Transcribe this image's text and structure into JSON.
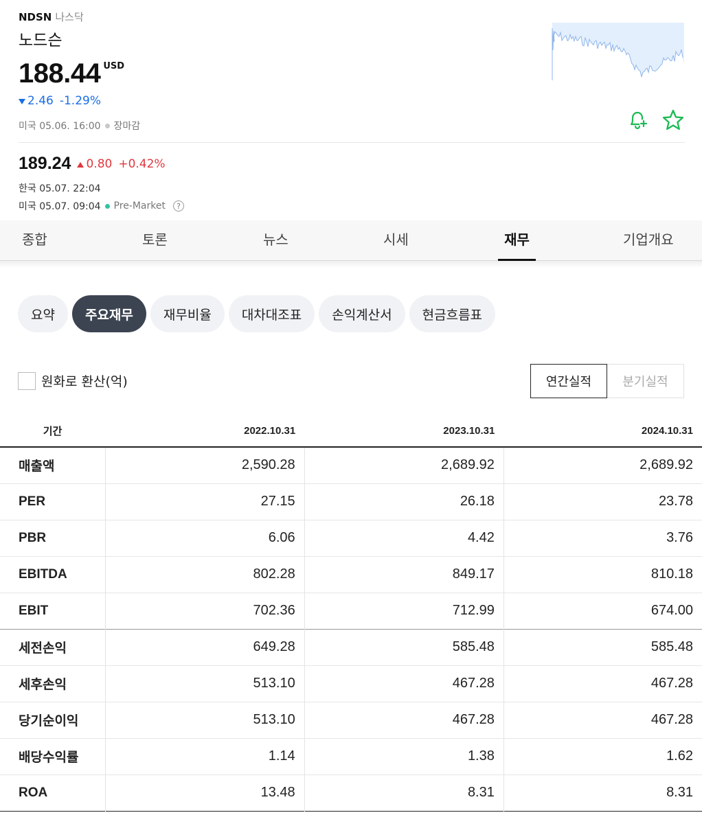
{
  "stock": {
    "ticker": "NDSN",
    "exchange": "나스닥",
    "name": "노드슨",
    "price": "188.44",
    "currency": "USD",
    "change": "2.46",
    "change_pct": "-1.29%",
    "market_time": "미국 05.06. 16:00",
    "market_status": "장마감"
  },
  "premarket": {
    "price": "189.24",
    "change": "0.80",
    "change_pct": "+0.42%",
    "kr_time": "한국 05.07. 22:04",
    "us_time": "미국 05.07. 09:04",
    "label": "Pre-Market"
  },
  "icons": {
    "alert": "bell-plus-icon",
    "favorite": "star-icon",
    "help": "question-circle-icon"
  },
  "colors": {
    "down": "#1a6ee6",
    "up": "#e0383e",
    "accent_green": "#1db954",
    "chip_active": "#3c4452"
  },
  "tabs": [
    {
      "label": "종합"
    },
    {
      "label": "토론"
    },
    {
      "label": "뉴스"
    },
    {
      "label": "시세"
    },
    {
      "label": "재무",
      "active": true
    },
    {
      "label": "기업개요"
    }
  ],
  "subtabs": [
    {
      "label": "요약"
    },
    {
      "label": "주요재무",
      "active": true
    },
    {
      "label": "재무비율"
    },
    {
      "label": "대차대조표"
    },
    {
      "label": "손익계산서"
    },
    {
      "label": "현금흐름표"
    }
  ],
  "convert_label": "원화로 환산(억)",
  "convert_checked": false,
  "period": {
    "annual": "연간실적",
    "quarterly": "분기실적",
    "selected": "annual"
  },
  "table": {
    "headers": [
      "기간",
      "2022.10.31",
      "2023.10.31",
      "2024.10.31"
    ],
    "rows": [
      {
        "label": "매출액",
        "values": [
          "2,590.28",
          "2,689.92",
          "2,689.92"
        ]
      },
      {
        "label": "PER",
        "values": [
          "27.15",
          "26.18",
          "23.78"
        ]
      },
      {
        "label": "PBR",
        "values": [
          "6.06",
          "4.42",
          "3.76"
        ]
      },
      {
        "label": "EBITDA",
        "values": [
          "802.28",
          "849.17",
          "810.18"
        ]
      },
      {
        "label": "EBIT",
        "values": [
          "702.36",
          "712.99",
          "674.00"
        ]
      },
      {
        "label": "세전손익",
        "values": [
          "649.28",
          "585.48",
          "585.48"
        ]
      },
      {
        "label": "세후손익",
        "values": [
          "513.10",
          "467.28",
          "467.28"
        ]
      },
      {
        "label": "당기순이익",
        "values": [
          "513.10",
          "467.28",
          "467.28"
        ]
      },
      {
        "label": "배당수익률",
        "values": [
          "1.14",
          "1.38",
          "1.62"
        ]
      },
      {
        "label": "ROA",
        "values": [
          "13.48",
          "8.31",
          "8.31"
        ]
      }
    ]
  }
}
